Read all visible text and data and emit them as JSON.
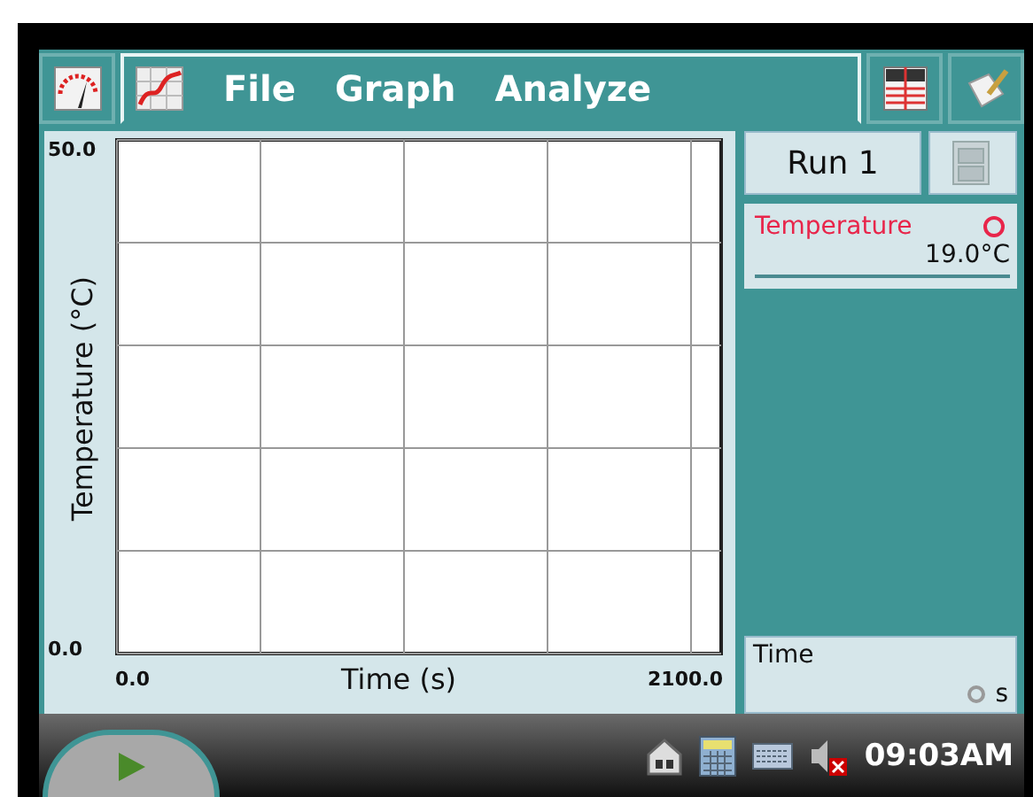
{
  "tabs": [
    {
      "kind": "meter",
      "selected": false
    },
    {
      "kind": "graph",
      "selected": true
    },
    {
      "kind": "table",
      "selected": false
    },
    {
      "kind": "notes",
      "selected": false
    }
  ],
  "menu": [
    "File",
    "Graph",
    "Analyze"
  ],
  "graph": {
    "y_label": "Temperature (°C)",
    "y_max": "50.0",
    "y_min": "0.0",
    "x_label": "Time (s)",
    "x_min": "0.0",
    "x_max": "2100.0"
  },
  "run_button": "Run 1",
  "sensors": [
    {
      "name": "Temperature",
      "value": "19.0°C",
      "color": "#e8254a"
    }
  ],
  "time_column": {
    "name": "Time",
    "unit": "s"
  },
  "status_bar": {
    "clock": "09:03AM",
    "sound_muted": true
  }
}
